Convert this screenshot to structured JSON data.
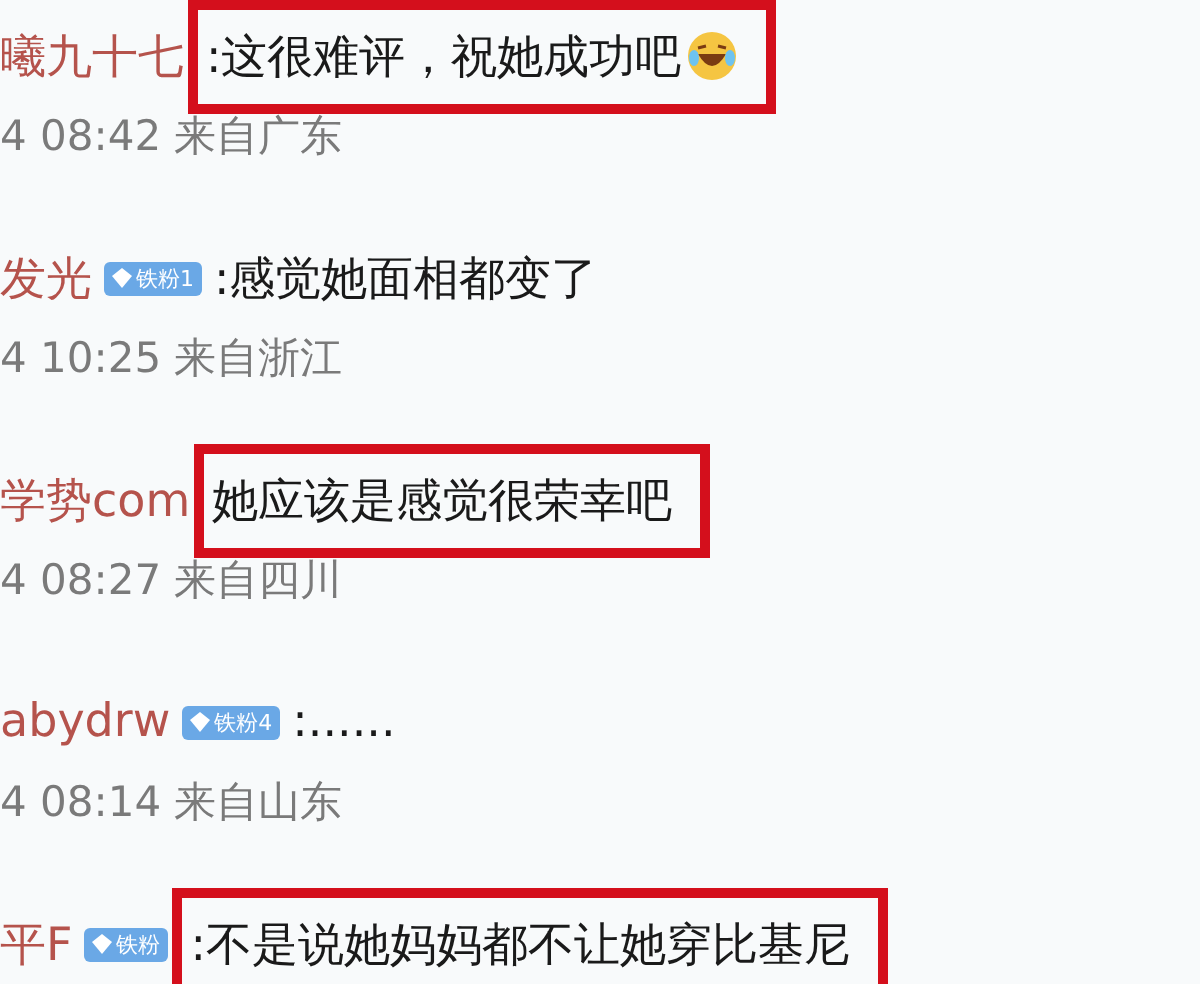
{
  "comments": [
    {
      "name": "曦九十七",
      "text": ":这很难评，祝她成功吧",
      "emoji": true,
      "highlighted": true,
      "meta": "4 08:42 来自广东"
    },
    {
      "name": "发光",
      "badge": "铁粉1",
      "text": ":感觉她面相都变了",
      "emoji": false,
      "highlighted": false,
      "meta": "4 10:25 来自浙江"
    },
    {
      "name": "学势com",
      "text": "她应该是感觉很荣幸吧",
      "emoji": false,
      "highlighted": true,
      "meta": "4 08:27 来自四川"
    },
    {
      "name": "abydrw",
      "badge": "铁粉4",
      "text": ":......",
      "emoji": false,
      "highlighted": false,
      "meta": "4 08:14 来自山东"
    },
    {
      "name": "平F",
      "badge": "铁粉",
      "text": ":不是说她妈妈都不让她穿比基尼",
      "emoji": false,
      "highlighted": true
    }
  ]
}
